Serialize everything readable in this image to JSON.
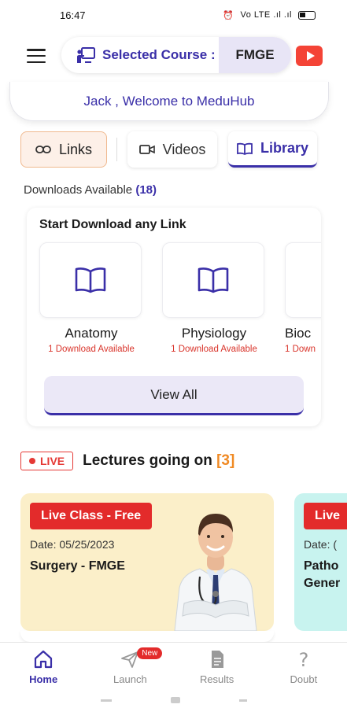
{
  "status_bar": {
    "time": "16:47",
    "signal": "Vo LTE .ıl .ıl",
    "battery_level": 0.35
  },
  "header": {
    "course_label": "Selected Course :",
    "course_value": "FMGE"
  },
  "welcome": {
    "text": "Jack , Welcome to MeduHub"
  },
  "tabs": [
    {
      "label": "Links",
      "icon": "link-icon",
      "state": "outlined"
    },
    {
      "label": "Videos",
      "icon": "video-icon",
      "state": "default"
    },
    {
      "label": "Library",
      "icon": "book-icon",
      "state": "active"
    }
  ],
  "downloads": {
    "label": "Downloads Available",
    "count": "(18)"
  },
  "download_card": {
    "title": "Start Download any Link",
    "subjects": [
      {
        "name": "Anatomy",
        "availability": "1 Download Available",
        "icon": "book-open-icon"
      },
      {
        "name": "Physiology",
        "availability": "1 Download Available",
        "icon": "book-open-icon"
      },
      {
        "name": "Bioc",
        "availability": "1 Down",
        "icon": "book-open-icon"
      }
    ],
    "view_all_label": "View All"
  },
  "live": {
    "badge": "LIVE",
    "title": "Lectures going on",
    "count": "[3]"
  },
  "lectures": [
    {
      "badge": "Live Class - Free",
      "date": "Date: 05/25/2023",
      "subject": "Surgery - FMGE",
      "color": "#fbefc9"
    },
    {
      "badge": "Live",
      "date": "Date: (",
      "subject": "Patho",
      "subject_line2": "Gener",
      "color": "#c8f3ef"
    }
  ],
  "bottom_nav": [
    {
      "label": "Home",
      "icon": "home-icon",
      "active": true
    },
    {
      "label": "Launch",
      "icon": "send-icon",
      "badge": "New"
    },
    {
      "label": "Results",
      "icon": "document-icon"
    },
    {
      "label": "Doubt",
      "icon": "question-icon"
    }
  ],
  "colors": {
    "accent": "#3a2fa8",
    "live_red": "#e32b2b",
    "count_orange": "#f08a24"
  }
}
